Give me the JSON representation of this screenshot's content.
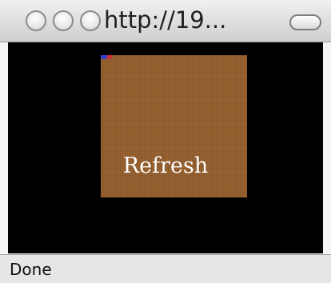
{
  "window": {
    "title": "http://19...",
    "buttons": [
      "close",
      "minimize",
      "zoom"
    ]
  },
  "page": {
    "background_color": "#000000",
    "canvas_color": "#9a6332",
    "marker_colors": [
      "#3d3fc8",
      "#c8323a"
    ],
    "refresh_label": "Refresh"
  },
  "status": {
    "text": "Done"
  }
}
